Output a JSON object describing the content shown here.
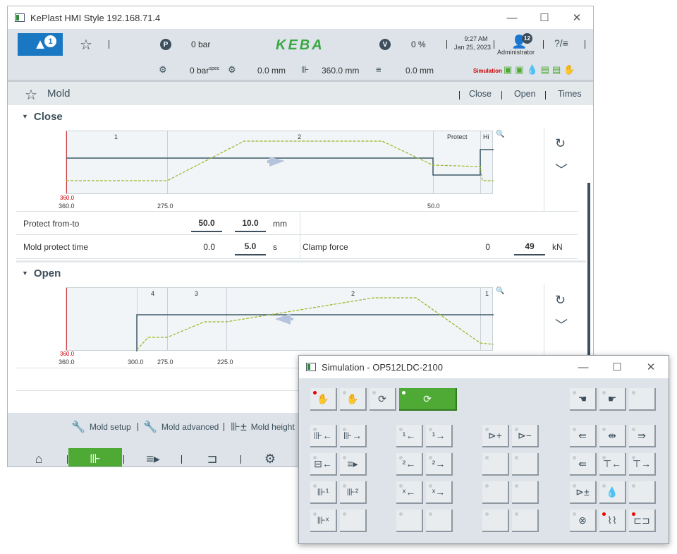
{
  "window": {
    "title": "KePlast HMI Style 192.168.71.4",
    "minimize": "—",
    "maximize": "☐",
    "close": "✕"
  },
  "header": {
    "alarm_count": "1",
    "pressure_value": "0 bar",
    "brand": "KEBA",
    "speed_value": "0 %",
    "time": "9:27 AM",
    "date": "Jan 25, 2023",
    "user": "Administrator",
    "user_badge": "12",
    "help": "?/≡",
    "spec_pressure": "0 bar",
    "spec_suffix": "spec",
    "pos1": "0.0 mm",
    "pos2": "360.0 mm",
    "pos3": "0.0 mm",
    "simulation_label": "Simulation",
    "colors": {
      "accent": "#4eaa34",
      "alarm": "#1a78c2",
      "dark": "#3d4f5c"
    }
  },
  "page": {
    "title": "Mold",
    "links": [
      "Close",
      "Open",
      "Times"
    ]
  },
  "close_section": {
    "title": "Close",
    "zones": [
      "1",
      "2",
      "Protect",
      "Hi"
    ],
    "ticks": [
      "360.0",
      "275.0",
      "50.0"
    ],
    "red_tick": "360.0",
    "protect_label": "Protect from-to",
    "protect_from": "50.0",
    "protect_to": "10.0",
    "protect_unit": "mm",
    "time_label": "Mold protect time",
    "time_actual": "0.0",
    "time_set": "5.0",
    "time_unit": "s",
    "clamp_label": "Clamp force",
    "clamp_actual": "0",
    "clamp_set": "49",
    "clamp_unit": "kN"
  },
  "open_section": {
    "title": "Open",
    "zones": [
      "4",
      "3",
      "2",
      "1"
    ],
    "ticks": [
      "360.0",
      "300.0",
      "275.0",
      "225.0"
    ],
    "red_tick": "360.0"
  },
  "footer": {
    "items": [
      "Mold setup",
      "Mold advanced",
      "Mold height"
    ]
  },
  "simulation": {
    "title": "Simulation - OP512LDC-2100"
  }
}
